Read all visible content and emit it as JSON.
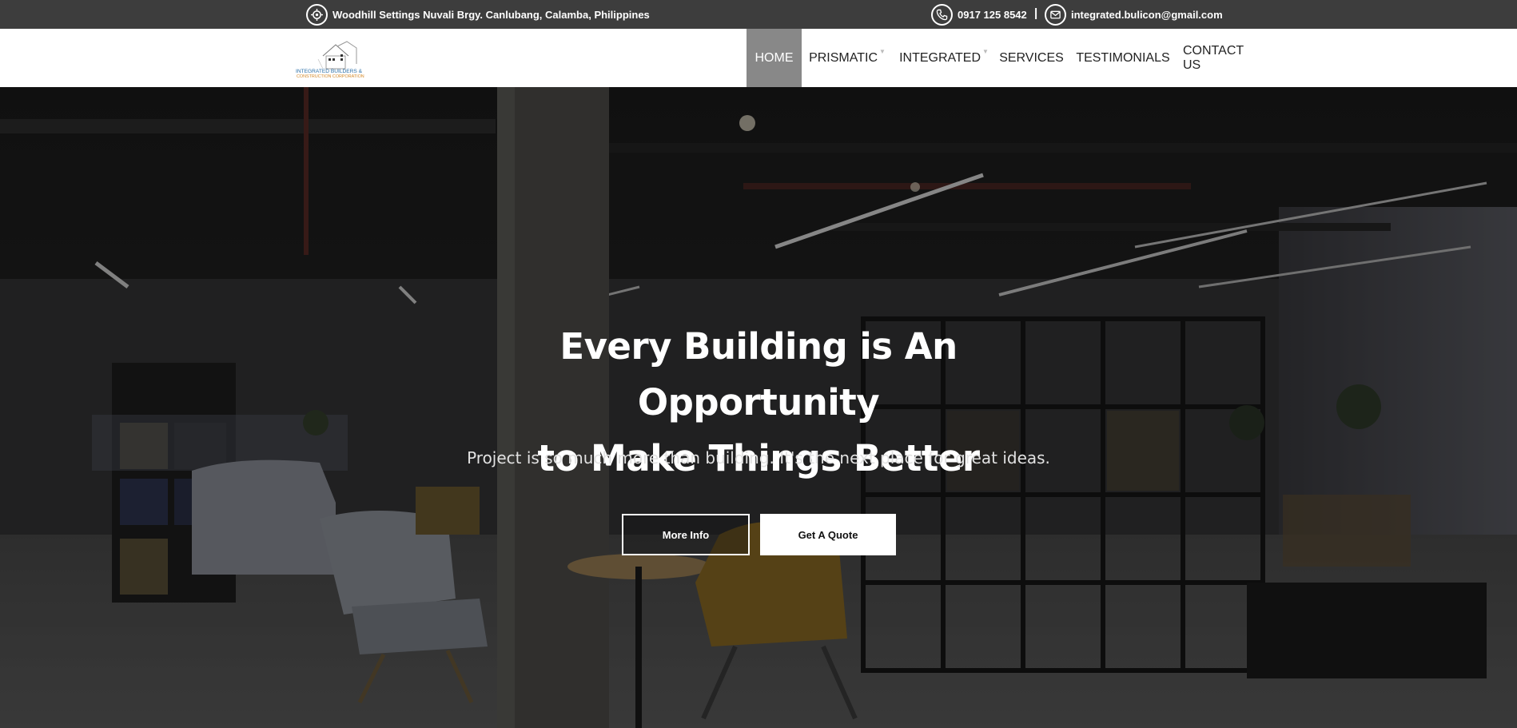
{
  "topbar": {
    "address": "Woodhill Settings Nuvali Brgy. Canlubang, Calamba, Philippines",
    "phone": "0917 125 8542",
    "separator": "|",
    "email": "integrated.bulicon@gmail.com",
    "icons": {
      "address": "location-target-icon",
      "phone": "phone-icon",
      "email": "envelope-icon"
    }
  },
  "logo": {
    "line1": "INTEGRATED BUILDERS &",
    "line2": "CONSTRUCTION CORPORATION"
  },
  "nav": {
    "items": [
      {
        "label": "HOME",
        "active": true
      },
      {
        "label": "PRISMATIC",
        "dropdown": true
      },
      {
        "label": "INTEGRATED",
        "dropdown": true
      },
      {
        "label": "SERVICES"
      },
      {
        "label": "TESTIMONIALS"
      },
      {
        "label": "CONTACT US"
      }
    ]
  },
  "hero": {
    "title_line1": "Every Building is An Opportunity",
    "title_line2": "to Make Things Better",
    "subtitle": "Project is so much more than building. It's the next place for great ideas.",
    "btn_more": "More Info",
    "btn_quote": "Get A Quote"
  },
  "colors": {
    "topbar": "#3d3d3d",
    "nav_active": "#888888",
    "nav_bg": "#ffffff"
  }
}
